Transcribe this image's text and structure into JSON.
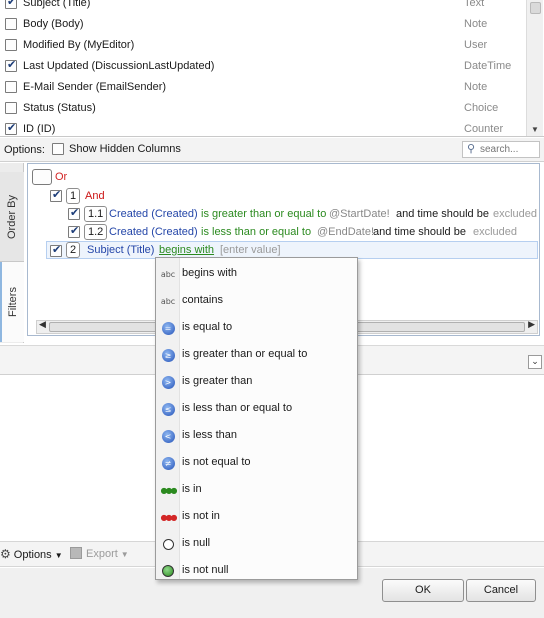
{
  "columns": [
    {
      "label": "Subject (Title)",
      "type": "Text",
      "checked": true
    },
    {
      "label": "Body (Body)",
      "type": "Note",
      "checked": false
    },
    {
      "label": "Modified By (MyEditor)",
      "type": "User",
      "checked": false
    },
    {
      "label": "Last Updated (DiscussionLastUpdated)",
      "type": "DateTime",
      "checked": true
    },
    {
      "label": "E-Mail Sender (EmailSender)",
      "type": "Note",
      "checked": false
    },
    {
      "label": "Status (Status)",
      "type": "Choice",
      "checked": false
    },
    {
      "label": "ID (ID)",
      "type": "Counter",
      "checked": true
    }
  ],
  "options": {
    "label": "Options:",
    "show_hidden": "Show Hidden Columns",
    "search_placeholder": "search..."
  },
  "tabs": {
    "order_by": "Order By",
    "filters": "Filters"
  },
  "filter": {
    "root": "Or",
    "group": {
      "num": "1",
      "label": "And"
    },
    "cond1": {
      "num": "1.1",
      "field": "Created (Created)",
      "operator": "is greater than or equal to",
      "param": "@StartDate!",
      "tail": "and time should be",
      "tail2": "excluded"
    },
    "cond2": {
      "num": "1.2",
      "field": "Created (Created)",
      "operator": "is less than or equal to",
      "param": "@EndDate!",
      "tail": "and time should be",
      "tail2": "excluded"
    },
    "cond3": {
      "num": "2",
      "field": "Subject (Title)",
      "operator": "begins with",
      "value_placeholder": "[enter value]"
    }
  },
  "menu": [
    {
      "label": "begins with",
      "icon": "abc-icon",
      "glyph": "abc"
    },
    {
      "label": "contains",
      "icon": "abc-icon",
      "glyph": "abc"
    },
    {
      "label": "is equal to",
      "icon": "equal-icon",
      "glyph": "="
    },
    {
      "label": "is greater than or equal to",
      "icon": "greater-equal-icon",
      "glyph": "≥"
    },
    {
      "label": "is greater than",
      "icon": "greater-icon",
      "glyph": ">"
    },
    {
      "label": "is less than or equal to",
      "icon": "less-equal-icon",
      "glyph": "≤"
    },
    {
      "label": "is less than",
      "icon": "less-icon",
      "glyph": "<"
    },
    {
      "label": "is not equal to",
      "icon": "not-equal-icon",
      "glyph": "≠"
    },
    {
      "label": "is in",
      "icon": "in-icon",
      "glyph": "●●●"
    },
    {
      "label": "is not in",
      "icon": "not-in-icon",
      "glyph": "●●●"
    },
    {
      "label": "is null",
      "icon": "null-icon",
      "glyph": ""
    },
    {
      "label": "is not null",
      "icon": "not-null-icon",
      "glyph": ""
    }
  ],
  "toolbar": {
    "options": "Options",
    "export": "Export"
  },
  "buttons": {
    "ok": "OK",
    "cancel": "Cancel"
  },
  "colors": {
    "or": "#d32626",
    "field": "#2446a8",
    "operator": "#2b8a1f",
    "in_dots": "#2b8a1f",
    "not_in_dots": "#d32626"
  }
}
